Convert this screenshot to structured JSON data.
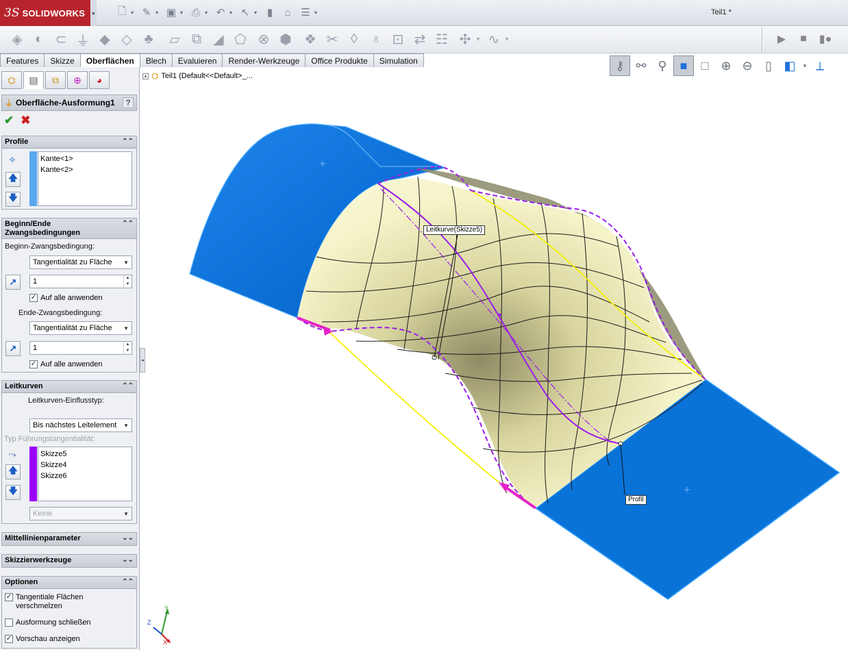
{
  "app": {
    "brand": "SOLIDWORKS",
    "brand_prefix": "3S",
    "document_title": "Teil1 *"
  },
  "quick_access": [
    {
      "icon": "new-document-icon"
    },
    {
      "icon": "open-folder-icon"
    },
    {
      "icon": "save-icon"
    },
    {
      "icon": "print-icon"
    },
    {
      "icon": "undo-icon"
    },
    {
      "icon": "select-arrow-icon"
    },
    {
      "icon": "rebuild-icon"
    },
    {
      "icon": "file-properties-icon"
    },
    {
      "icon": "options-icon"
    }
  ],
  "command_icons": [
    "extruded-surface-icon",
    "revolved-surface-icon",
    "swept-surface-icon",
    "lofted-surface-icon",
    "boundary-surface-icon",
    "filled-surface-icon",
    "freeform-icon",
    "planar-surface-icon",
    "offset-surface-icon",
    "ruled-surface-icon",
    "surface-flatten-icon",
    "delete-face-icon",
    "replace-face-icon",
    "extend-surface-icon",
    "trim-surface-icon",
    "untrim-surface-icon",
    "knit-surface-icon",
    "thicken-icon",
    "thicken-cut-icon",
    "cut-with-surface-icon",
    "move-copy-bodies-icon",
    "delete-hole-icon",
    "mid-surface-icon"
  ],
  "run_buttons": [
    "play-icon",
    "stop-icon",
    "record-icon"
  ],
  "tabs": [
    {
      "label": "Features",
      "active": false
    },
    {
      "label": "Skizze",
      "active": false
    },
    {
      "label": "Oberflächen",
      "active": true
    },
    {
      "label": "Blech",
      "active": false
    },
    {
      "label": "Evaluieren",
      "active": false
    },
    {
      "label": "Render-Werkzeuge",
      "active": false
    },
    {
      "label": "Office Produkte",
      "active": false
    },
    {
      "label": "Simulation",
      "active": false
    }
  ],
  "view_toolbar": [
    "previous-view-icon",
    "zoom-to-fit-icon",
    "zoom-to-area-icon",
    "shaded-display-icon",
    "hidden-lines-icon",
    "zoom-in-icon",
    "zoom-out-icon",
    "section-view-icon",
    "view-orientation-icon",
    "normal-to-icon"
  ],
  "tree": {
    "root_label": "Teil1  (Default<<Default>_..."
  },
  "panel": {
    "tabs": [
      "feature-manager-icon",
      "property-manager-icon",
      "configuration-manager-icon",
      "dim-xpert-icon",
      "display-manager-icon"
    ],
    "feature_title": "Oberfläche-Ausformung1",
    "help": "?",
    "profile": {
      "title": "Profile",
      "items": [
        "Kante<1>",
        "Kante<2>"
      ],
      "bar_color": "#5aa7ee"
    },
    "constraints": {
      "title": "Beginn/Ende Zwangsbedingungen",
      "start_label": "Beginn-Zwangsbedingung:",
      "start_value": "Tangentialität zu Fläche",
      "start_weight": "1",
      "start_apply_all": "Auf alle anwenden",
      "end_label": "Ende-Zwangsbedingung:",
      "end_value": "Tangentialität zu Fläche",
      "end_weight": "1",
      "end_apply_all": "Auf alle anwenden"
    },
    "guides": {
      "title": "Leitkurven",
      "influence_label": "Leitkurven-Einflusstyp:",
      "influence_value": "Bis nächstes Leitelement",
      "tangency_label": "Typ Führungstangentialität:",
      "items": [
        "Skizze5",
        "Skizze4",
        "Skizze6"
      ],
      "bar_color": "#9b00ff",
      "tangency_value": "Keine"
    },
    "centerline": {
      "title": "Mittellinienparameter"
    },
    "sketch_tools": {
      "title": "Skizzierwerkzeuge"
    },
    "options": {
      "title": "Optionen",
      "merge_tangent": "Tangentiale Flächen verschmelzen",
      "close_loft": "Ausformung schließen",
      "show_preview": "Vorschau anzeigen"
    }
  },
  "graphics": {
    "callout_guide": "Leitkurve(Skizze5)",
    "callout_profile": "Profil",
    "colors": {
      "face_blue": "#0a73d8",
      "loft_fill": "#f1efbf",
      "guide_purple": "#9a1de8",
      "yellow_curve": "#f2f000",
      "connector_magenta": "#e523c9"
    },
    "triad": {
      "x": "X",
      "y": "Y",
      "z": "Z"
    }
  }
}
